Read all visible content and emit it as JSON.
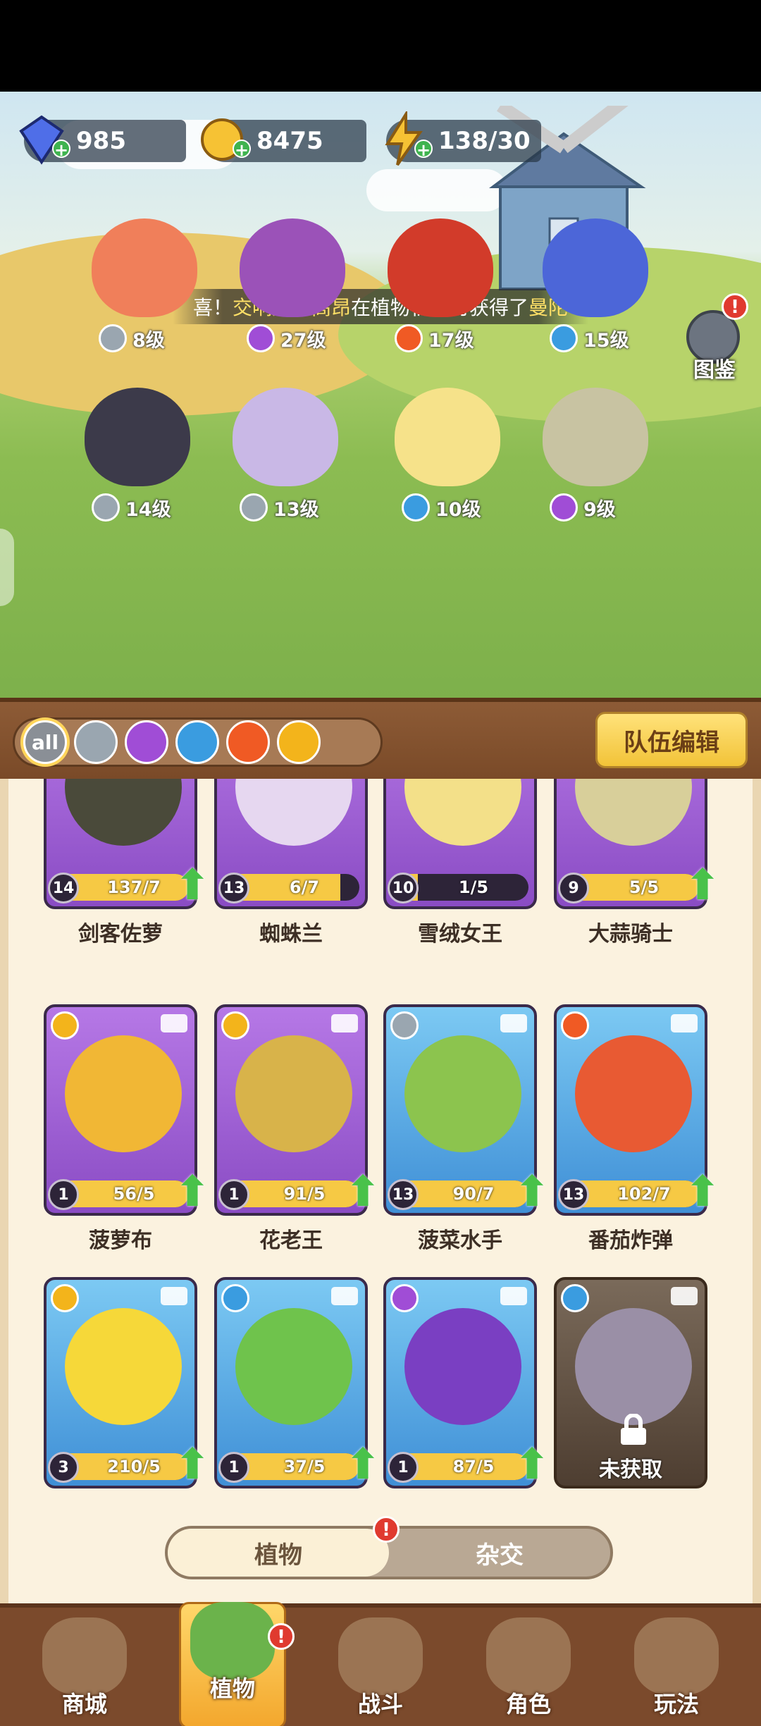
{
  "resources": [
    {
      "icon": "gem-icon",
      "value": "985"
    },
    {
      "icon": "coin-icon",
      "value": "8475"
    },
    {
      "icon": "energy-icon",
      "value": "138/30"
    }
  ],
  "ticker": {
    "prefix": "喜！",
    "player": "交响风华高昂",
    "middle": "在植物祈愿时获得了",
    "item": "曼陀"
  },
  "codex": {
    "label": "图鉴",
    "alert": "!"
  },
  "heroes": [
    {
      "element": "sword",
      "level": "8级",
      "color": "#f07f5a"
    },
    {
      "element": "poison",
      "level": "27级",
      "color": "#9b52b8"
    },
    {
      "element": "fire",
      "level": "17级",
      "color": "#d23b2a"
    },
    {
      "element": "water",
      "level": "15级",
      "color": "#4c66d8"
    },
    {
      "element": "sword",
      "level": "14级",
      "color": "#3c3a4a"
    },
    {
      "element": "sword",
      "level": "13级",
      "color": "#c9b8e6"
    },
    {
      "element": "water",
      "level": "10级",
      "color": "#f6e28a"
    },
    {
      "element": "poison",
      "level": "9级",
      "color": "#c8c3a2"
    }
  ],
  "filters": [
    {
      "key": "all",
      "label": "all",
      "active": true
    },
    {
      "key": "sword"
    },
    {
      "key": "poison"
    },
    {
      "key": "water"
    },
    {
      "key": "fire"
    },
    {
      "key": "bolt"
    }
  ],
  "team_edit_label": "队伍编辑",
  "cards": [
    {
      "name": "剑客佐萝",
      "level": "14",
      "progress": "137/7",
      "ratio": 1.0,
      "style": "purple",
      "element": "",
      "upgrade": true,
      "art": "#4a4a3a"
    },
    {
      "name": "蜘蛛兰",
      "level": "13",
      "progress": "6/7",
      "ratio": 0.857,
      "style": "purple",
      "element": "",
      "upgrade": false,
      "art": "#e6d7f0"
    },
    {
      "name": "雪绒女王",
      "level": "10",
      "progress": "1/5",
      "ratio": 0.2,
      "style": "purple",
      "element": "",
      "upgrade": false,
      "art": "#f3e089"
    },
    {
      "name": "大蒜骑士",
      "level": "9",
      "progress": "5/5",
      "ratio": 1.0,
      "style": "purple",
      "element": "",
      "upgrade": true,
      "art": "#d8cf9a"
    },
    {
      "name": "菠萝布",
      "level": "1",
      "progress": "56/5",
      "ratio": 1.0,
      "style": "purple",
      "element": "bolt",
      "upgrade": true,
      "art": "#f1b735"
    },
    {
      "name": "花老王",
      "level": "1",
      "progress": "91/5",
      "ratio": 1.0,
      "style": "purple",
      "element": "bolt",
      "upgrade": true,
      "art": "#d8b34a"
    },
    {
      "name": "菠菜水手",
      "level": "13",
      "progress": "90/7",
      "ratio": 1.0,
      "style": "blue",
      "element": "sword",
      "upgrade": true,
      "art": "#8cc44e"
    },
    {
      "name": "番茄炸弹",
      "level": "13",
      "progress": "102/7",
      "ratio": 1.0,
      "style": "blue",
      "element": "fire",
      "upgrade": true,
      "art": "#e85a33"
    },
    {
      "name": "",
      "level": "3",
      "progress": "210/5",
      "ratio": 1.0,
      "style": "blue",
      "element": "bolt",
      "upgrade": true,
      "art": "#f6d839"
    },
    {
      "name": "",
      "level": "1",
      "progress": "37/5",
      "ratio": 1.0,
      "style": "blue",
      "element": "water",
      "upgrade": true,
      "art": "#6fc34c"
    },
    {
      "name": "",
      "level": "1",
      "progress": "87/5",
      "ratio": 1.0,
      "style": "blue",
      "element": "poison",
      "upgrade": true,
      "art": "#7a3fc2"
    },
    {
      "name": "",
      "level": "",
      "progress": "",
      "ratio": 0,
      "style": "locked",
      "element": "water",
      "upgrade": false,
      "art": "#9a8fa6",
      "locked_label": "未获取"
    }
  ],
  "mode_toggle": {
    "left": "植物",
    "right": "杂交",
    "alert": "!"
  },
  "nav": [
    {
      "label": "商城",
      "icon": "shop-icon"
    },
    {
      "label": "植物",
      "icon": "plants-icon",
      "active": true,
      "alert": "!"
    },
    {
      "label": "战斗",
      "icon": "battle-icon"
    },
    {
      "label": "角色",
      "icon": "character-icon"
    },
    {
      "label": "玩法",
      "icon": "gameplay-icon"
    }
  ],
  "colors": {
    "sword": "#9aa6b0",
    "poison": "#a04dd6",
    "water": "#3a9ce0",
    "fire": "#f05a24",
    "bolt": "#f3b41b"
  }
}
